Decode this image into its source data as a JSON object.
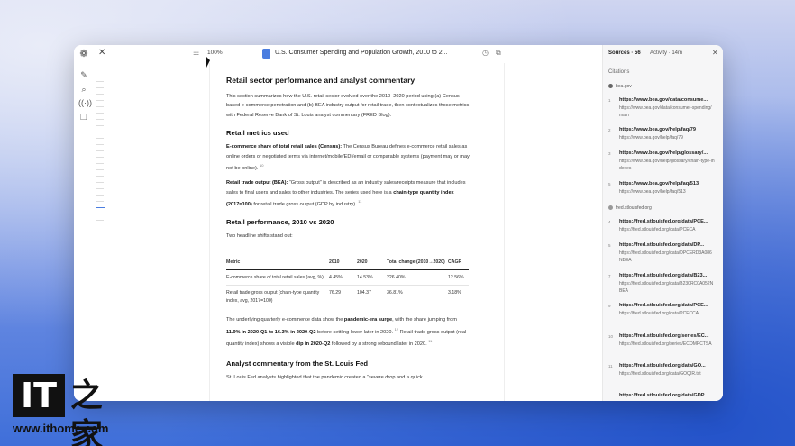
{
  "toolbar": {
    "zoom": "100%",
    "doc_title": "U.S. Consumer Spending and Population Growth, 2010 to 2..."
  },
  "rpanel": {
    "tab_sources": "Sources · 56",
    "tab_activity": "Activity · 14m",
    "citations_heading": "Citations",
    "group1": "bea.gov",
    "group2": "fred.stlouisfed.org",
    "items": [
      {
        "n": "1",
        "u": "https://www.bea.gov/data/consume...",
        "d": "https://www.bea.gov/data/consumer-spending/main"
      },
      {
        "n": "2",
        "u": "https://www.bea.gov/help/faq/79",
        "d": "https://www.bea.gov/help/faq/79"
      },
      {
        "n": "3",
        "u": "https://www.bea.gov/help/glossary/...",
        "d": "https://www.bea.gov/help/glossary/chain-type-indexes"
      },
      {
        "n": "5",
        "u": "https://www.bea.gov/help/faq/513",
        "d": "https://www.bea.gov/help/faq/513"
      },
      {
        "n": "4",
        "u": "https://fred.stlouisfed.org/data/PCE...",
        "d": "https://fred.stlouisfed.org/data/PCECA"
      },
      {
        "n": "5",
        "u": "https://fred.stlouisfed.org/data/DP...",
        "d": "https://fred.stlouisfed.org/data/DPCERD3A086NBEA"
      },
      {
        "n": "7",
        "u": "https://fred.stlouisfed.org/data/B23...",
        "d": "https://fred.stlouisfed.org/data/B230RC0A052NBEA"
      },
      {
        "n": "9",
        "u": "https://fred.stlouisfed.org/data/PCE...",
        "d": "https://fred.stlouisfed.org/data/PCECCA"
      },
      {
        "n": "10",
        "u": "https://fred.stlouisfed.org/series/EC...",
        "d": "https://fred.stlouisfed.org/series/ECOMPCTSA"
      },
      {
        "n": "11",
        "u": "https://fred.stlouisfed.org/data/GO...",
        "d": "https://fred.stlouisfed.org/data/GOQIR.txt"
      },
      {
        "n": "",
        "u": "https://fred.stlouisfed.org/data/GDP...",
        "d": ""
      }
    ]
  },
  "doc": {
    "h_main": "Retail sector performance and analyst commentary",
    "intro": "This section summarizes how the U.S. retail sector evolved over the 2010–2020 period using (a) Census-based e-commerce penetration and (b) BEA industry output for retail trade, then contextualizes those metrics with Federal Reserve Bank of St. Louis analyst commentary (FRED Blog).",
    "h_metrics": "Retail metrics used",
    "m1_label": "E-commerce share of total retail sales (Census):",
    "m1_text": " The Census Bureau defines e-commerce retail sales as online orders or negotiated terms via internet/mobile/EDI/email or comparable systems (payment may or may not be online).",
    "m1_ref": "10",
    "m2_label": "Retail trade output (BEA):",
    "m2_text_a": " “Gross output” is described as an industry sales/receipts measure that includes sales to final users and sales to other industries. The series used here is a ",
    "m2_bold": "chain-type quantity index (2017=100)",
    "m2_text_b": " for retail trade gross output (GDP by industry).",
    "m2_ref": "11",
    "h_perf": "Retail performance, 2010 vs 2020",
    "perf_intro": "Two headline shifts stand out:",
    "table": {
      "headers": [
        "Metric",
        "2010",
        "2020",
        "Total change (2010→2020)",
        "CAGR"
      ],
      "rows": [
        [
          "E-commerce share of total retail sales (avg, %)",
          "4.45%",
          "14.53%",
          "226.40%",
          "12.56%"
        ],
        [
          "Retail trade gross output (chain-type quantity index, avg, 2017=100)",
          "76.29",
          "104.37",
          "36.81%",
          "3.18%"
        ]
      ]
    },
    "q_text_a": "The underlying quarterly e-commerce data show the ",
    "q_bold1": "pandemic-era surge",
    "q_text_b": ", with the share jumping from ",
    "q_bold2": "11.9% in 2020-Q1 to 16.3% in 2020-Q2",
    "q_text_c": " before settling lower later in 2020.",
    "q_ref1": "12",
    "q_text_d": " Retail trade gross output (real quantity index) shows a visible ",
    "q_bold3": "dip in 2020-Q2",
    "q_text_e": " followed by a strong rebound later in 2020.",
    "q_ref2": "11",
    "h_analyst": "Analyst commentary from the St. Louis Fed",
    "analyst_text": "St. Louis Fed analysts highlighted that the pandemic created a “severe drop and a quick"
  },
  "watermark": {
    "logo_it": "IT",
    "logo_zh": "之家",
    "url": "www.ithome.com"
  }
}
